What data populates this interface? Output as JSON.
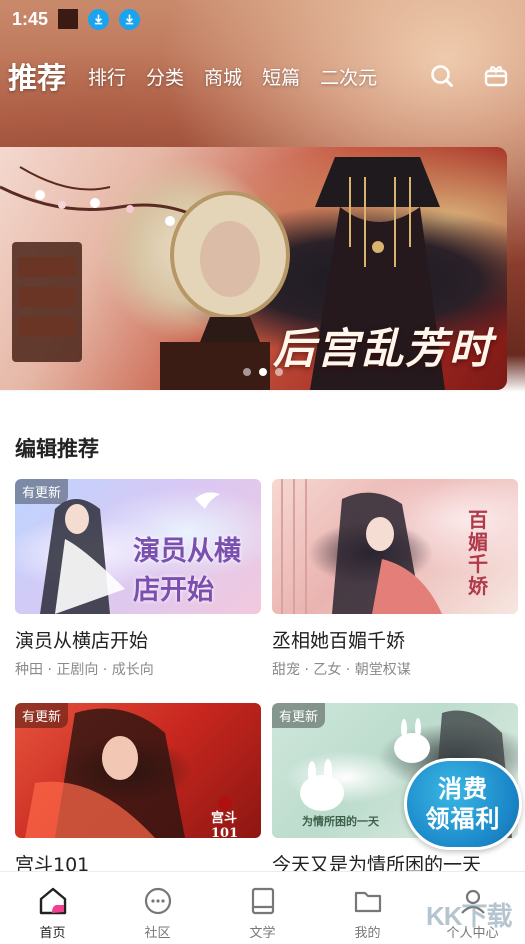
{
  "status_bar": {
    "time": "1:45",
    "icons": [
      "square-icon",
      "download-icon",
      "download-icon"
    ],
    "download_color": "#1aa3ef"
  },
  "top_nav": {
    "tabs": [
      {
        "label": "推荐",
        "active": true
      },
      {
        "label": "排行",
        "active": false
      },
      {
        "label": "分类",
        "active": false
      },
      {
        "label": "商城",
        "active": false
      },
      {
        "label": "短篇",
        "active": false
      },
      {
        "label": "二次元",
        "active": false
      }
    ],
    "icons": [
      "search-icon",
      "gift-icon"
    ]
  },
  "banner": {
    "title": "后宫乱芳时",
    "dots": 3,
    "active_dot": 1
  },
  "section": {
    "title": "编辑推荐"
  },
  "cards": [
    {
      "title": "演员从横店开始",
      "tags": "种田 · 正剧向 · 成长向",
      "badge": "有更新",
      "cover_text": "演员从横店开始"
    },
    {
      "title": "丞相她百媚千娇",
      "tags": "甜宠 · 乙女 · 朝堂权谋",
      "badge": "",
      "cover_text": "百媚千娇"
    },
    {
      "title": "宫斗101",
      "tags": "",
      "badge": "有更新",
      "cover_text": "宫斗101"
    },
    {
      "title": "今天又是为情所困的一天",
      "tags": "",
      "badge": "有更新",
      "cover_text": "为情所困的一天"
    }
  ],
  "promo": {
    "line1": "消费",
    "line2": "领福利"
  },
  "tab_bar": {
    "items": [
      {
        "label": "首页",
        "icon": "home-icon",
        "active": true
      },
      {
        "label": "社区",
        "icon": "community-icon",
        "active": false
      },
      {
        "label": "文学",
        "icon": "book-icon",
        "active": false
      },
      {
        "label": "我的",
        "icon": "folder-icon",
        "active": false
      },
      {
        "label": "个人中心",
        "icon": "profile-icon",
        "active": false
      }
    ],
    "accent": "#f0418f"
  },
  "watermark": "KK下载"
}
